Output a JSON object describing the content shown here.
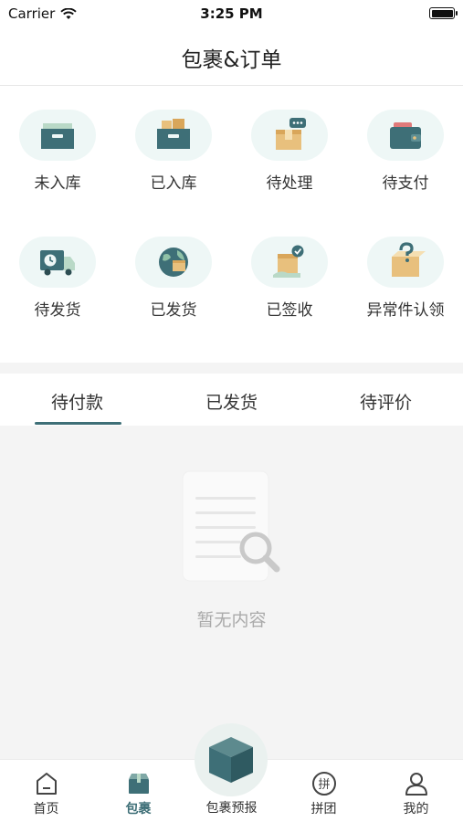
{
  "status_bar": {
    "carrier": "Carrier",
    "time": "3:25 PM"
  },
  "header": {
    "title": "包裹&订单"
  },
  "package_status": [
    {
      "label": "未入库",
      "icon": "drawer-box-icon"
    },
    {
      "label": "已入库",
      "icon": "stocked-drawer-icon"
    },
    {
      "label": "待处理",
      "icon": "box-chat-icon"
    },
    {
      "label": "待支付",
      "icon": "wallet-icon"
    },
    {
      "label": "待发货",
      "icon": "delivery-truck-icon"
    },
    {
      "label": "已发货",
      "icon": "globe-parcel-icon"
    },
    {
      "label": "已签收",
      "icon": "signed-parcel-icon"
    },
    {
      "label": "异常件认领",
      "icon": "question-box-icon"
    }
  ],
  "order_tabs": {
    "items": [
      "待付款",
      "已发货",
      "待评价"
    ],
    "active_index": 0
  },
  "empty_state": {
    "text": "暂无内容"
  },
  "bottom_nav": {
    "items": [
      "首页",
      "包裹",
      "拼团",
      "我的"
    ],
    "center_label": "包裹预报",
    "active": "包裹"
  },
  "colors": {
    "accent": "#3e6f77",
    "icon_bubble": "#eef7f6",
    "box_tan": "#e8c07d",
    "page_bg": "#f4f4f4"
  }
}
